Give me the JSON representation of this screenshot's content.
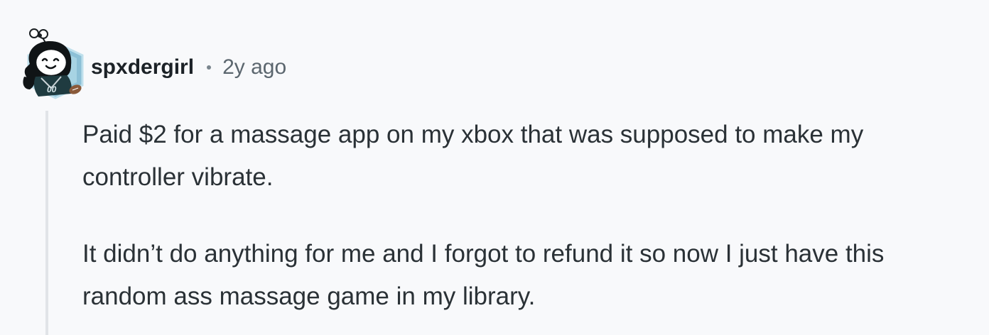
{
  "comment": {
    "author": "spxdergirl",
    "timestamp": "2y ago",
    "avatar": {
      "icon": "snoo-avatar-icon",
      "jersey_text": "00",
      "colors": {
        "hair": "#101416",
        "skin": "#ffffff",
        "badge": "#7fb6cf",
        "jersey": "#1f3b40"
      }
    },
    "paragraphs": [
      "Paid $2 for a massage app on my xbox that was supposed to make my controller vibrate.",
      "It didn’t do anything for me and I forgot to refund it so now I just have this random ass massage game in my library."
    ]
  }
}
